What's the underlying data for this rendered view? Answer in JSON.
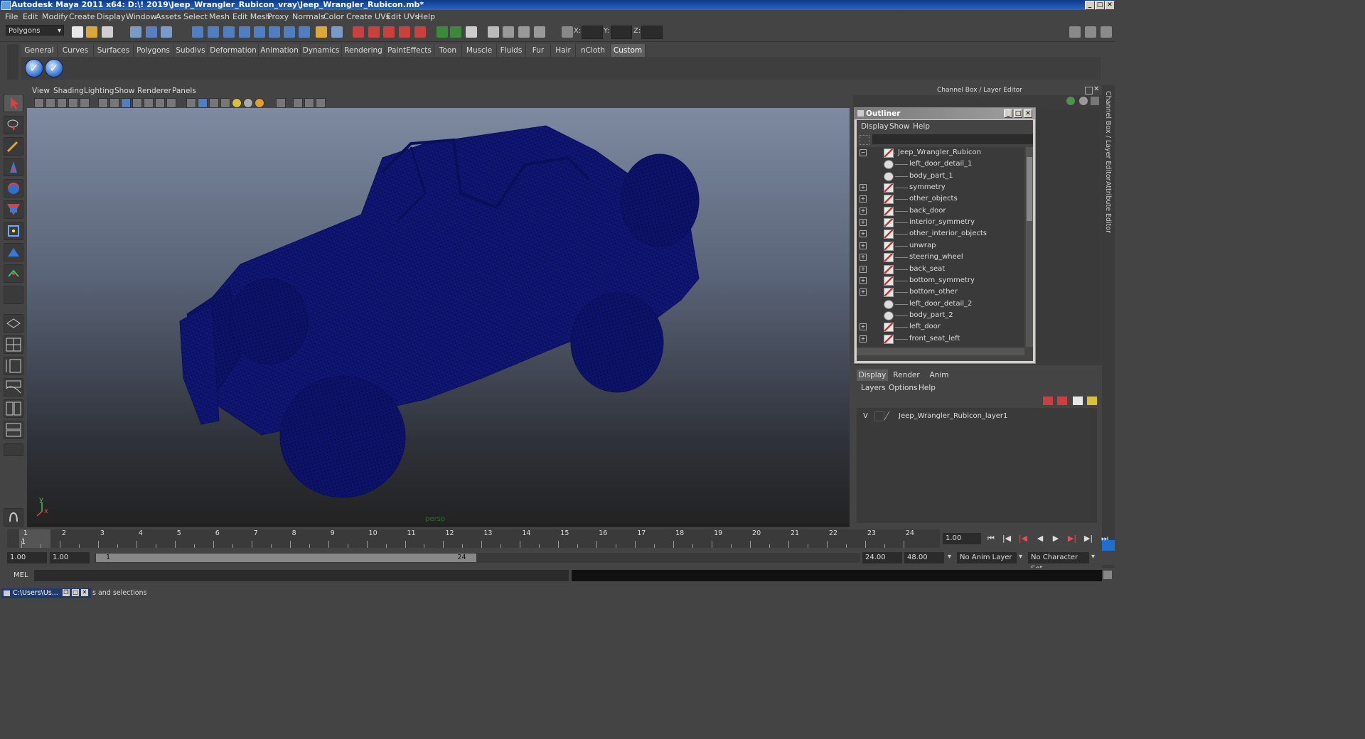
{
  "window": {
    "title": "Autodesk Maya 2011 x64: D:\\! 2019\\Jeep_Wrangler_Rubicon_vray\\Jeep_Wrangler_Rubicon.mb*"
  },
  "menubar": [
    "File",
    "Edit",
    "Modify",
    "Create",
    "Display",
    "Window",
    "Assets",
    "Select",
    "Mesh",
    "Edit Mesh",
    "Proxy",
    "Normals",
    "Color",
    "Create UVs",
    "Edit UVs",
    "Help"
  ],
  "statusline": {
    "mode": "Polygons",
    "x_label": "X:",
    "y_label": "Y:",
    "z_label": "Z:"
  },
  "shelf": {
    "tabs": [
      "General",
      "Curves",
      "Surfaces",
      "Polygons",
      "Subdivs",
      "Deformation",
      "Animation",
      "Dynamics",
      "Rendering",
      "PaintEffects",
      "Toon",
      "Muscle",
      "Fluids",
      "Fur",
      "Hair",
      "nCloth",
      "Custom"
    ],
    "active_tab": "Custom"
  },
  "viewport": {
    "menu": [
      "View",
      "Shading",
      "Lighting",
      "Show",
      "Renderer",
      "Panels"
    ],
    "camera_label": "persp",
    "axis_y": "y",
    "axis_x": "x",
    "wire_color": "#0e1470"
  },
  "channel_box": {
    "header": "Channel Box / Layer Editor",
    "side_tabs": [
      "Channel Box / Layer Editor",
      "Attribute Editor"
    ]
  },
  "outliner": {
    "title": "Outliner",
    "menu": [
      "Display",
      "Show",
      "Help"
    ],
    "items": [
      {
        "label": "Jeep_Wrangler_Rubicon",
        "expander": "−",
        "icon": "mesh",
        "indent": 0
      },
      {
        "label": "left_door_detail_1",
        "expander": "",
        "icon": "grp",
        "indent": 1
      },
      {
        "label": "body_part_1",
        "expander": "",
        "icon": "grp",
        "indent": 1
      },
      {
        "label": "symmetry",
        "expander": "+",
        "icon": "mesh",
        "indent": 1
      },
      {
        "label": "other_objects",
        "expander": "+",
        "icon": "mesh",
        "indent": 1
      },
      {
        "label": "back_door",
        "expander": "+",
        "icon": "mesh",
        "indent": 1
      },
      {
        "label": "interior_symmetry",
        "expander": "+",
        "icon": "mesh",
        "indent": 1
      },
      {
        "label": "other_interior_objects",
        "expander": "+",
        "icon": "mesh",
        "indent": 1
      },
      {
        "label": "unwrap",
        "expander": "+",
        "icon": "mesh",
        "indent": 1
      },
      {
        "label": "steering_wheel",
        "expander": "+",
        "icon": "mesh",
        "indent": 1
      },
      {
        "label": "back_seat",
        "expander": "+",
        "icon": "mesh",
        "indent": 1
      },
      {
        "label": "bottom_symmetry",
        "expander": "+",
        "icon": "mesh",
        "indent": 1
      },
      {
        "label": "bottom_other",
        "expander": "+",
        "icon": "mesh",
        "indent": 1
      },
      {
        "label": "left_door_detail_2",
        "expander": "",
        "icon": "grp",
        "indent": 1
      },
      {
        "label": "body_part_2",
        "expander": "",
        "icon": "grp",
        "indent": 1
      },
      {
        "label": "left_door",
        "expander": "+",
        "icon": "mesh",
        "indent": 1
      },
      {
        "label": "front_seat_left",
        "expander": "+",
        "icon": "mesh",
        "indent": 1
      }
    ]
  },
  "layer_editor": {
    "tabs": [
      "Display",
      "Render",
      "Anim"
    ],
    "active_tab": "Display",
    "menu": [
      "Layers",
      "Options",
      "Help"
    ],
    "layers": [
      {
        "visible": "V",
        "name": "Jeep_Wrangler_Rubicon_layer1"
      }
    ]
  },
  "timeline": {
    "ticks": [
      "1",
      "2",
      "3",
      "4",
      "5",
      "6",
      "7",
      "8",
      "9",
      "10",
      "11",
      "12",
      "13",
      "14",
      "15",
      "16",
      "17",
      "18",
      "19",
      "20",
      "21",
      "22",
      "23",
      "24"
    ],
    "current_marker": "1",
    "current_frame": "1.00"
  },
  "range": {
    "start": "1.00",
    "playback_start": "1.00",
    "bar_start": "1",
    "bar_end": "24",
    "playback_end": "24.00",
    "end": "48.00",
    "anim_layer": "No Anim Layer",
    "character_set": "No Character Set",
    "fill_fraction": 0.5
  },
  "command_line": {
    "label": "MEL"
  },
  "help_line": {
    "task_window": "C:\\Users\\Us...",
    "text": "s and selections"
  }
}
